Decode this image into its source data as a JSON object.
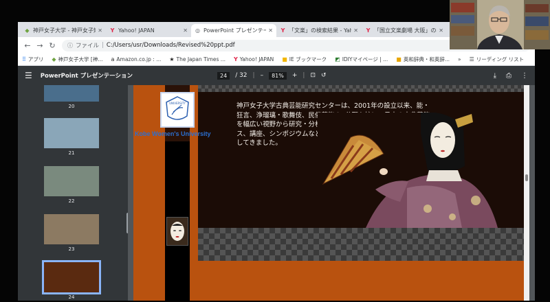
{
  "tabs": [
    {
      "label": "神戸女子大学 - 神戸女子短期",
      "icon": "kobe-favicon",
      "active": false
    },
    {
      "label": "Yahoo! JAPAN",
      "icon": "yahoo-favicon",
      "active": false
    },
    {
      "label": "PowerPoint プレゼンテーション",
      "icon": "globe-favicon",
      "active": true
    },
    {
      "label": "「文楽」の検索結果 - Yahoo!",
      "icon": "yahoo-favicon",
      "active": false
    },
    {
      "label": "「国立文楽劇場 大阪」の検索",
      "icon": "yahoo-favicon",
      "active": false
    }
  ],
  "address": {
    "scheme": "ファイル",
    "url": "C:/Users/usr/Downloads/Revised%20ppt.pdf"
  },
  "bookmarks": [
    {
      "label": "アプリ",
      "icon": "apps-icon"
    },
    {
      "label": "神戸女子大学 [神...",
      "icon": "kobe-favicon"
    },
    {
      "label": "Amazon.co.jp : ...",
      "icon": "amazon-icon"
    },
    {
      "label": "The Japan Times ...",
      "icon": "star-icon"
    },
    {
      "label": "Yahoo! JAPAN",
      "icon": "yahoo-favicon"
    },
    {
      "label": "IE ブックマーク",
      "icon": "folder-icon"
    },
    {
      "label": "IDIYマイページ | ...",
      "icon": "idiy-icon"
    },
    {
      "label": "英和辞典・和英辞...",
      "icon": "dictionary-icon"
    }
  ],
  "bookmarks_more": "»",
  "reading_list": "リーディング リスト",
  "pdf": {
    "title": "PowerPoint プレゼンテーション",
    "page_current": "24",
    "page_total": "/ 32",
    "zoom": "81%",
    "zoom_out": "–",
    "zoom_in": "+"
  },
  "thumbnails": [
    {
      "num": "20",
      "color": "#4a6e8c",
      "selected": false
    },
    {
      "num": "21",
      "color": "#8aa6b8",
      "selected": false
    },
    {
      "num": "22",
      "color": "#7a8a7e",
      "selected": false
    },
    {
      "num": "23",
      "color": "#8c7a62",
      "selected": false
    },
    {
      "num": "24",
      "color": "#5a2a10",
      "selected": true
    }
  ],
  "slide": {
    "logo_text": "Kobe Women's University",
    "logo_mark": "UNIVERSITY",
    "body": "神戸女子大学古典芸能研究センターは、2001年の設立以来、能・狂言、浄瑠璃・歌舞伎、民俗芸能の3分野を柱に、日本の古典芸能を幅広い視野から研究・分析し、その成果を刊行物、データベース、講座、シンポジウムなどの形で社会に還元していく活動を展開してきました。"
  }
}
